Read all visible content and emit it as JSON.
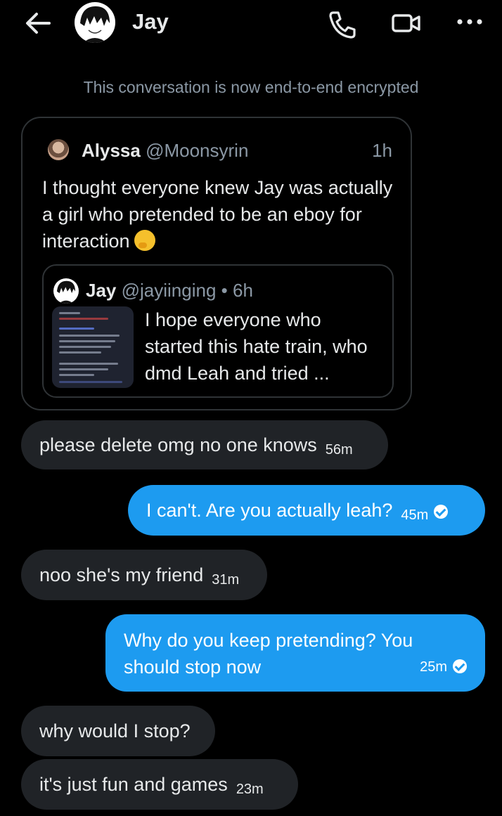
{
  "header": {
    "name": "Jay"
  },
  "notice": "This conversation is now end-to-end encrypted",
  "shared_tweet": {
    "author_name": "Alyssa",
    "author_handle": "@Moonsyrin",
    "time": "1h",
    "text": "I thought everyone knew Jay was actually a girl who pretended to be an eboy for interaction",
    "quoted": {
      "name": "Jay",
      "handle": "@jayiinging",
      "time": "• 6h",
      "text": "I hope everyone who started this hate train, who dmd Leah and tried ..."
    }
  },
  "messages": [
    {
      "dir": "recv",
      "text": "please delete omg no one knows",
      "time": "56m"
    },
    {
      "dir": "sent",
      "text": "I can't. Are you actually leah?",
      "time": "45m"
    },
    {
      "dir": "recv",
      "text": "noo she's my friend",
      "time": "31m"
    },
    {
      "dir": "sent",
      "text": "Why do you keep pretending? You should stop now",
      "time": "25m"
    },
    {
      "dir": "recv",
      "text": "why would I stop?",
      "time": ""
    },
    {
      "dir": "recv",
      "text": "it's just fun and games",
      "time": "23m"
    }
  ],
  "colors": {
    "accent": "#1d9bf0",
    "received_bubble": "#202327",
    "muted_text": "#8b98a5"
  }
}
